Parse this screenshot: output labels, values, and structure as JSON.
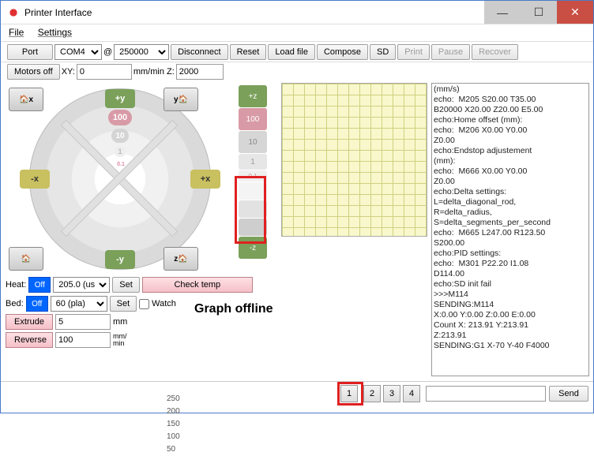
{
  "window": {
    "title": "Printer Interface"
  },
  "menu": {
    "file": "File",
    "settings": "Settings"
  },
  "toolbar": {
    "port": "Port",
    "com": "COM4",
    "at": "@",
    "baud": "250000",
    "disconnect": "Disconnect",
    "reset": "Reset",
    "loadfile": "Load file",
    "compose": "Compose",
    "sd": "SD",
    "print": "Print",
    "pause": "Pause",
    "recover": "Recover"
  },
  "row2": {
    "motors": "Motors off",
    "xy": "XY:",
    "xyval": "0",
    "mmmin": "mm/min Z:",
    "zval": "2000"
  },
  "jog": {
    "homex": "x",
    "homey": "y",
    "homez": "z",
    "plusy": "+y",
    "minusy": "-y",
    "plusx": "+x",
    "minusx": "-x",
    "plusz": "+z",
    "minusz": "-z",
    "v100": "100",
    "v10": "10",
    "v1": "1",
    "v01": "0.1"
  },
  "heat": {
    "heatlabel": "Heat:",
    "bedlabel": "Bed:",
    "on": "Off",
    "heatpreset": "205.0 (us",
    "bedpreset": "60 (pla)",
    "set": "Set",
    "checktemp": "Check temp",
    "watch": "Watch"
  },
  "extrude": {
    "extrude": "Extrude",
    "reverse": "Reverse",
    "len": "5",
    "speed": "100",
    "mm": "mm",
    "mmmin": "mm/\nmin"
  },
  "scale": {
    "s250": "250",
    "s200": "200",
    "s150": "150",
    "s100": "100",
    "s50": "50"
  },
  "graph": {
    "offline": "Graph offline"
  },
  "pages": {
    "p1": "1",
    "p2": "2",
    "p3": "3",
    "p4": "4"
  },
  "send": {
    "label": "Send"
  },
  "console": {
    "lines": "(mm/s)\necho:  M205 S20.00 T35.00\nB20000 X20.00 Z20.00 E5.00\necho:Home offset (mm):\necho:  M206 X0.00 Y0.00\nZ0.00\necho:Endstop adjustement\n(mm):\necho:  M666 X0.00 Y0.00\nZ0.00\necho:Delta settings:\nL=delta_diagonal_rod,\nR=delta_radius,\nS=delta_segments_per_second\necho:  M665 L247.00 R123.50\nS200.00\necho:PID settings:\necho:  M301 P22.20 I1.08\nD114.00\necho:SD init fail\n>>>M114\nSENDING:M114\nX:0.00 Y:0.00 Z:0.00 E:0.00\nCount X: 213.91 Y:213.91\nZ:213.91\nSENDING:G1 X-70 Y-40 F4000"
  }
}
